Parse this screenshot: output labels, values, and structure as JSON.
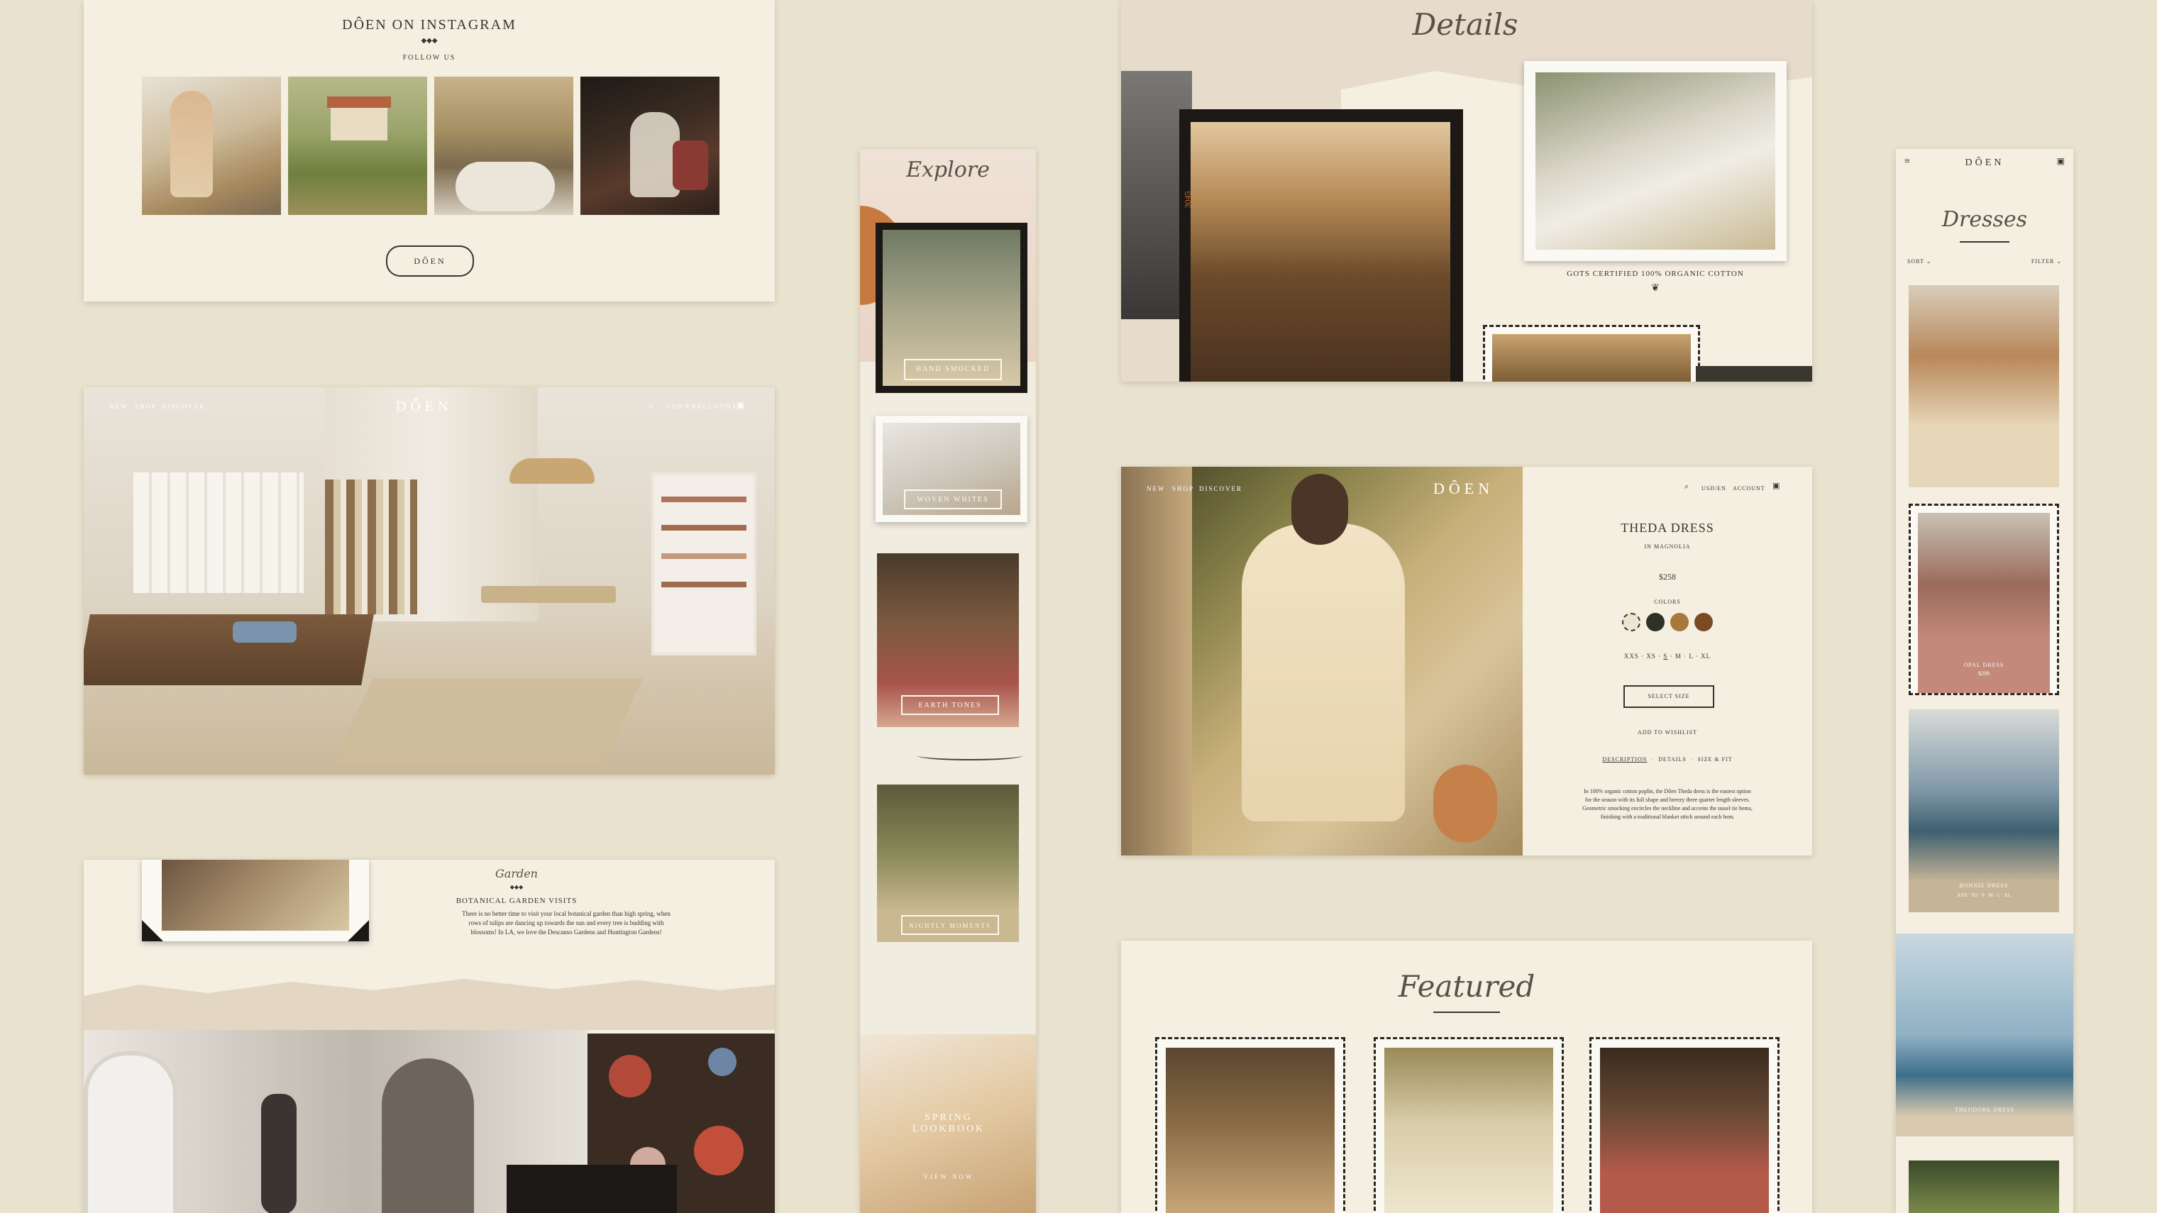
{
  "brand": "DÔEN",
  "instagram": {
    "title": "DÔEN ON INSTAGRAM",
    "diamonds": "◆◆◆",
    "subtitle": "FOLLOW US",
    "logo": "DÔEN"
  },
  "store": {
    "nav": [
      "NEW",
      "SHOP",
      "DISCOVER"
    ],
    "logo": "DÔEN",
    "right_nav": [
      "USD/EN",
      "ACCOUNT"
    ]
  },
  "garden": {
    "script": "Garden",
    "diamonds": "◆◆◆",
    "title": "BOTANICAL GARDEN VISITS",
    "body": "There is no better time to visit your local botanical garden than high spring, when rows of tulips are dancing up towards the sun and every tree is budding with blossoms! In LA, we love the Descanso Gardens and Huntington Gardens!"
  },
  "explore": {
    "script": "Explore",
    "labels": [
      "HAND SMOCKED",
      "WOVEN WHITES",
      "EARTH TONES",
      "NIGHTLY MOMENTS"
    ],
    "lookbook_title": "SPRING LOOKBOOK",
    "lookbook_cta": "VIEW NOW"
  },
  "details": {
    "script": "Details",
    "film_number": "3045",
    "caption": "GOTS CERTIFIED 100% ORGANIC COTTON"
  },
  "product": {
    "nav": [
      "NEW",
      "SHOP",
      "DISCOVER"
    ],
    "logo": "DÔEN",
    "right_nav": [
      "USD/EN",
      "ACCOUNT"
    ],
    "name": "THEDA DRESS",
    "variant": "IN MAGNOLIA",
    "price": "$258",
    "colors_label": "COLORS",
    "colors": [
      "#efe4cf",
      "#2f3126",
      "#a9793a",
      "#7b4a22"
    ],
    "sizes": [
      "XXS",
      "XS",
      "S",
      "M",
      "L",
      "XL"
    ],
    "select_size": "SELECT SIZE",
    "wishlist": "ADD TO WISHLIST",
    "tabs": [
      "DESCRIPTION",
      "DETAILS",
      "SIZE & FIT"
    ],
    "description": "In 100% organic cotton poplin, the Dôen Theda dress is the easiest option for the season with its full shape and breezy three quarter length sleeves. Geometric smocking encircles the neckline and accents the tassel tie hems, finishing with a traditional blanket stitch around each hem."
  },
  "featured": {
    "script": "Featured"
  },
  "mobile": {
    "logo": "DÔEN",
    "script": "Dresses",
    "sort": "SORT",
    "filter": "FILTER",
    "labels": [
      "OPAL DRESS",
      "BONNIE DRESS",
      "THEODORE DRESS"
    ],
    "sublabel": "$298",
    "sizes": "XXS · XS · S · M · L · XL"
  },
  "colors": {
    "background": "#e9e2cf",
    "paper": "#f4efe1",
    "ink": "#3a342c",
    "accent": "#b48a5a"
  }
}
